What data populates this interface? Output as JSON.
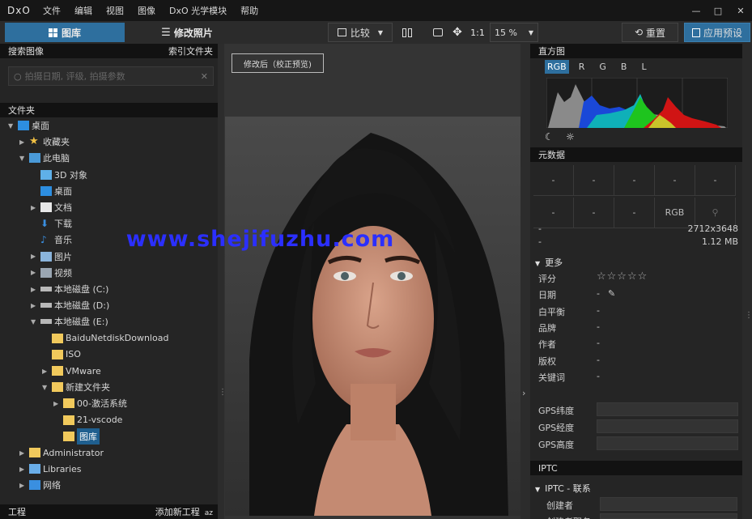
{
  "menubar": {
    "logo": "DxO",
    "items": [
      "文件",
      "编辑",
      "视图",
      "图像",
      "DxO 光学模块",
      "帮助"
    ],
    "minimize": "—",
    "maximize": "□",
    "close": "✕"
  },
  "toolbar": {
    "library_tab": "图库",
    "customize_tab": "修改照片",
    "compare": "比较",
    "one_to_one": "1:1",
    "zoom": "15 %",
    "reset": "重置",
    "apply_preset": "应用预设"
  },
  "left": {
    "search_header": "搜索图像",
    "index_folder": "索引文件夹",
    "search_placeholder": "拍摄日期, 评级, 拍摄参数",
    "folders_header": "文件夹",
    "tree": [
      {
        "label": "桌面",
        "level": 0,
        "arrow": "▼",
        "icon": "blue"
      },
      {
        "label": "收藏夹",
        "level": 1,
        "arrow": "▶",
        "icon": "star"
      },
      {
        "label": "此电脑",
        "level": 1,
        "arrow": "▼",
        "icon": "pc"
      },
      {
        "label": "3D 对象",
        "level": 2,
        "arrow": "",
        "icon": "cube"
      },
      {
        "label": "桌面",
        "level": 2,
        "arrow": "",
        "icon": "blue"
      },
      {
        "label": "文档",
        "level": 2,
        "arrow": "▶",
        "icon": "doc"
      },
      {
        "label": "下载",
        "level": 2,
        "arrow": "",
        "icon": "down"
      },
      {
        "label": "音乐",
        "level": 2,
        "arrow": "",
        "icon": "music"
      },
      {
        "label": "图片",
        "level": 2,
        "arrow": "▶",
        "icon": "img"
      },
      {
        "label": "视频",
        "level": 2,
        "arrow": "▶",
        "icon": "vid"
      },
      {
        "label": "本地磁盘 (C:)",
        "level": 2,
        "arrow": "▶",
        "icon": "disk"
      },
      {
        "label": "本地磁盘 (D:)",
        "level": 2,
        "arrow": "▶",
        "icon": "disk"
      },
      {
        "label": "本地磁盘 (E:)",
        "level": 2,
        "arrow": "▼",
        "icon": "disk"
      },
      {
        "label": "BaiduNetdiskDownload",
        "level": 3,
        "arrow": "",
        "icon": "fold"
      },
      {
        "label": "ISO",
        "level": 3,
        "arrow": "",
        "icon": "fold"
      },
      {
        "label": "VMware",
        "level": 3,
        "arrow": "▶",
        "icon": "fold"
      },
      {
        "label": "新建文件夹",
        "level": 3,
        "arrow": "▼",
        "icon": "fold"
      },
      {
        "label": "00-激活系统",
        "level": 4,
        "arrow": "▶",
        "icon": "fold"
      },
      {
        "label": "21-vscode",
        "level": 4,
        "arrow": "",
        "icon": "fold"
      },
      {
        "label": "图库",
        "level": 4,
        "arrow": "",
        "icon": "fold",
        "selected": true
      },
      {
        "label": "Administrator",
        "level": 1,
        "arrow": "▶",
        "icon": "fold"
      },
      {
        "label": "Libraries",
        "level": 1,
        "arrow": "▶",
        "icon": "lib"
      },
      {
        "label": "网络",
        "level": 1,
        "arrow": "▶",
        "icon": "net"
      }
    ],
    "project_header": "工程",
    "add_project": "添加新工程",
    "sort": "az"
  },
  "center": {
    "badge": "修改后（校正预览)",
    "watermark": "www.shejifuzhu.com"
  },
  "right": {
    "histogram_header": "直方图",
    "channels": [
      "RGB",
      "R",
      "G",
      "B",
      "L"
    ],
    "metadata_header": "元数据",
    "meta_grid_row1": [
      "-",
      "-",
      "-",
      "-",
      "-"
    ],
    "meta_grid_row2": [
      "-",
      "-",
      "-",
      "RGB",
      ""
    ],
    "dimensions": "2712x3648",
    "filesize": "1.12 MB",
    "dash": "-",
    "more": "更多",
    "fields": [
      {
        "label": "评分",
        "value": "☆☆☆☆☆"
      },
      {
        "label": "日期",
        "value": "-"
      },
      {
        "label": "白平衡",
        "value": "-"
      },
      {
        "label": "品牌",
        "value": "-"
      },
      {
        "label": "作者",
        "value": "-"
      },
      {
        "label": "版权",
        "value": "-"
      },
      {
        "label": "关键词",
        "value": "-"
      }
    ],
    "gps": [
      "GPS纬度",
      "GPS经度",
      "GPS高度"
    ],
    "iptc_header": "IPTC",
    "iptc_contact": "IPTC - 联系",
    "creator": "创建者",
    "creator_title": "创建者职务"
  },
  "colors": {
    "accent": "#2e6f9e",
    "selected": "#1f5f8f"
  }
}
